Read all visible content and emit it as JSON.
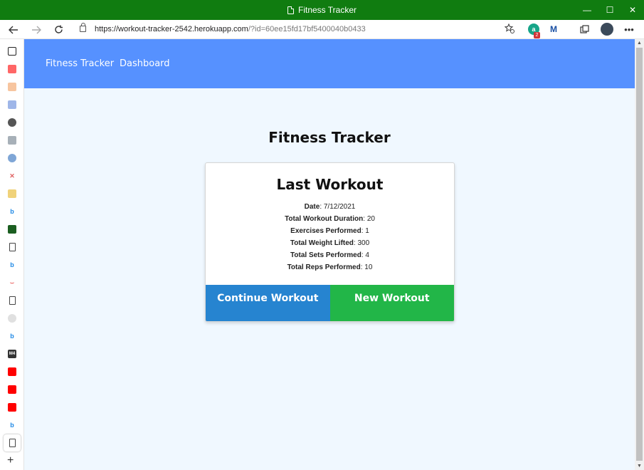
{
  "window": {
    "title": "Fitness Tracker",
    "controls": {
      "minimize": "—",
      "maximize": "☐",
      "close": "✕"
    }
  },
  "browser": {
    "url_main": "https://workout-tracker-2542.herokuapp.com",
    "url_query": "/?id=60ee15fd17bf5400040b0433",
    "extension_badge": "2",
    "icons": [
      "back-icon",
      "forward-icon",
      "refresh-icon",
      "lock-icon",
      "favorites-icon",
      "extension-icon",
      "collections-icon",
      "profile-icon",
      "more-icon"
    ]
  },
  "app": {
    "nav": {
      "brand": "Fitness Tracker",
      "dashboard": "Dashboard"
    },
    "title": "Fitness Tracker",
    "card": {
      "heading": "Last Workout",
      "stats": [
        {
          "label": "Date",
          "value": "7/12/2021"
        },
        {
          "label": "Total Workout Duration",
          "value": "20"
        },
        {
          "label": "Exercises Performed",
          "value": "1"
        },
        {
          "label": "Total Weight Lifted",
          "value": "300"
        },
        {
          "label": "Total Sets Performed",
          "value": "4"
        },
        {
          "label": "Total Reps Performed",
          "value": "10"
        }
      ],
      "continue_label": "Continue Workout",
      "new_label": "New Workout"
    },
    "colors": {
      "nav": "#5691ff",
      "background": "#f0f8ff",
      "continue": "#2684d0",
      "new": "#22b648"
    }
  }
}
